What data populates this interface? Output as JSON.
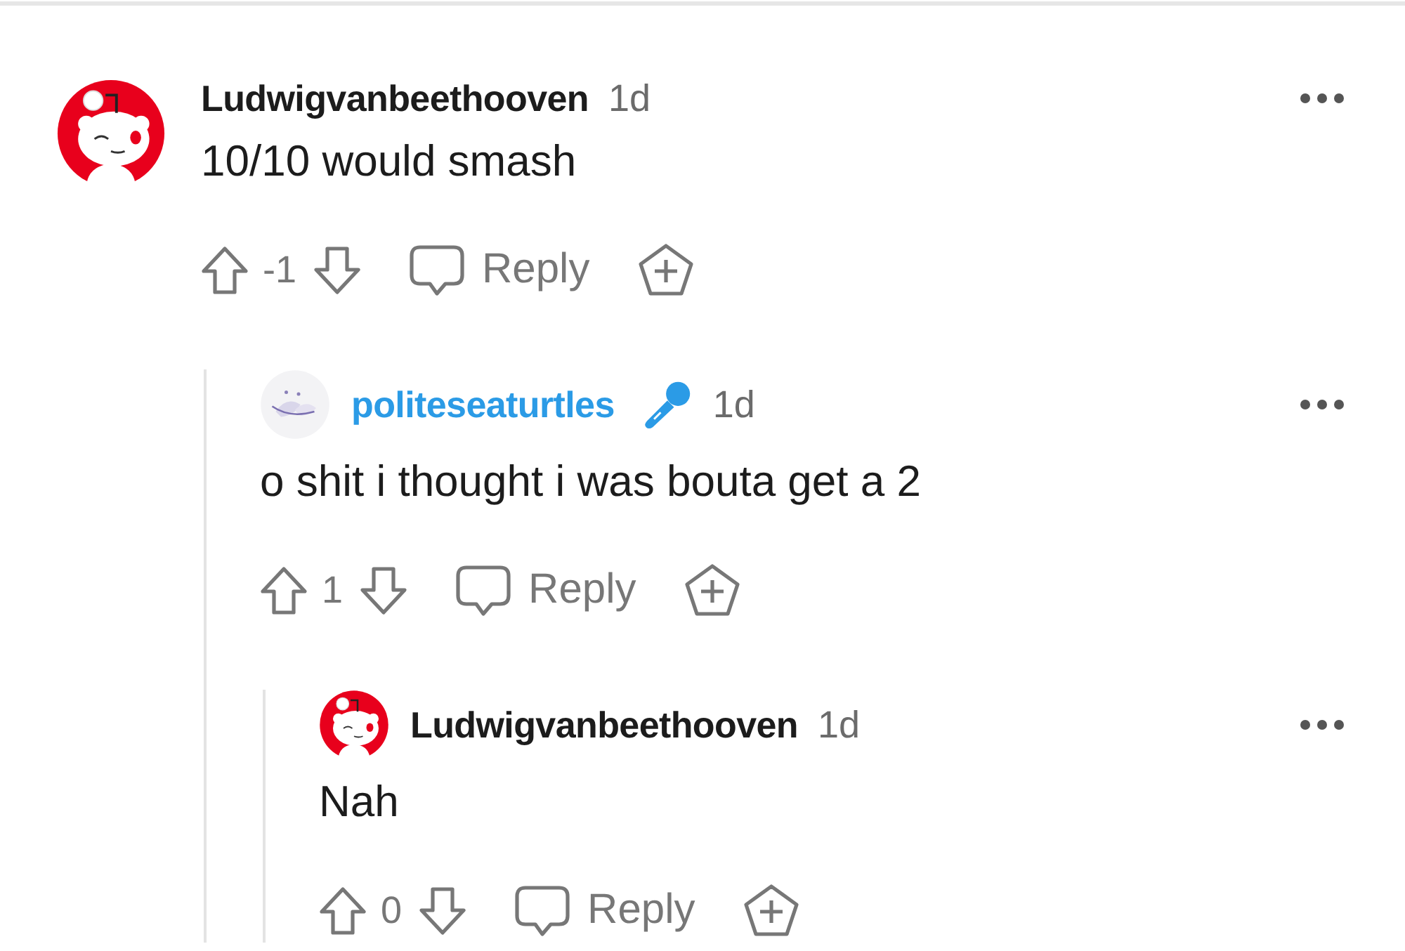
{
  "comments": [
    {
      "author": "Ludwigvanbeethooven",
      "highlighted": false,
      "avatar": {
        "kind": "mascot"
      },
      "mic_badge": false,
      "time": "1d",
      "body": "10/10 would smash",
      "score": "-1",
      "reply_label": "Reply",
      "children": [
        {
          "author": "politeseaturtles",
          "highlighted": true,
          "mic_badge": true,
          "time": "1d",
          "body": "o shit i thought i was bouta get a 2",
          "score": "1",
          "reply_label": "Reply",
          "children": [
            {
              "author": "Ludwigvanbeethooven",
              "highlighted": false,
              "avatar": {
                "kind": "mascot"
              },
              "mic_badge": false,
              "time": "1d",
              "body": "Nah",
              "score": "0",
              "reply_label": "Reply"
            }
          ]
        }
      ]
    }
  ]
}
